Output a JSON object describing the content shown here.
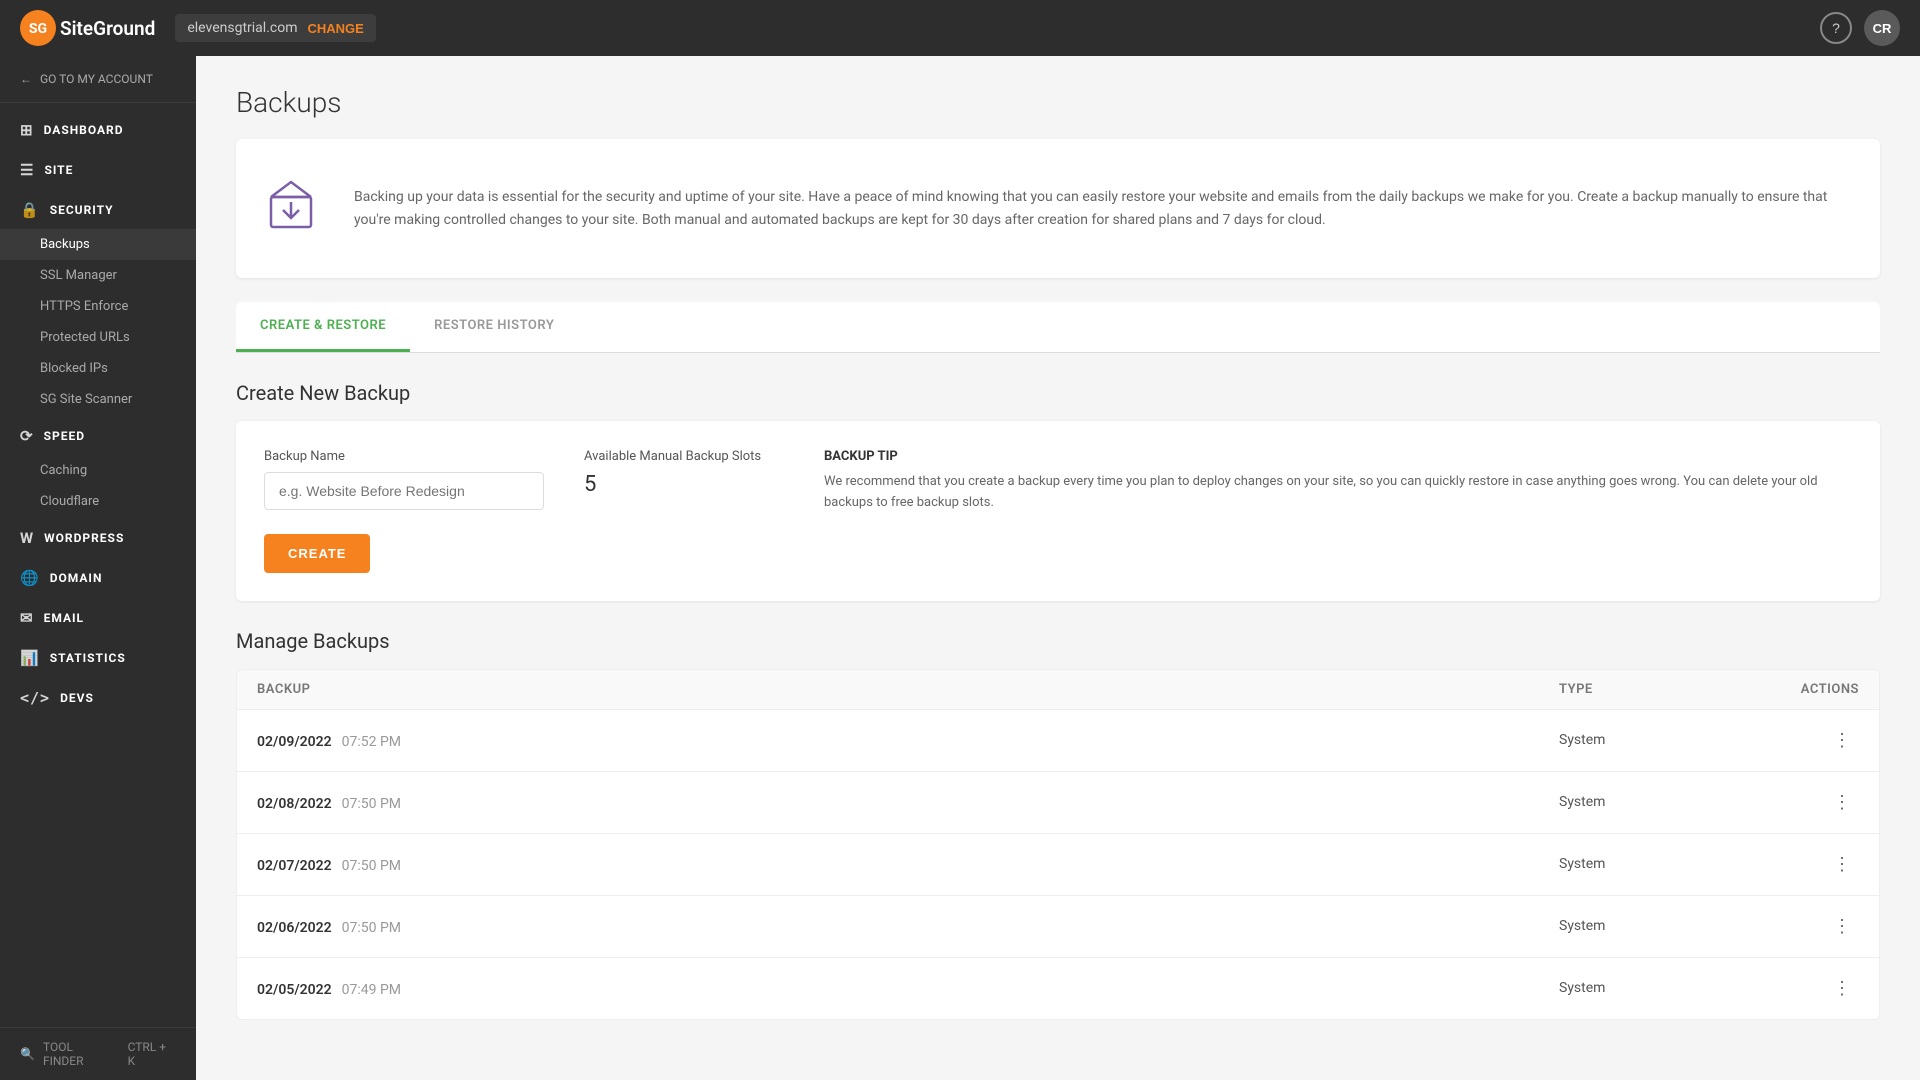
{
  "topnav": {
    "site_name": "elevensgtrial.com",
    "change_label": "CHANGE",
    "help_icon": "?",
    "avatar_label": "CR"
  },
  "sidebar": {
    "go_to_account": "GO TO MY ACCOUNT",
    "items": [
      {
        "id": "dashboard",
        "label": "DASHBOARD",
        "icon": "⊞"
      },
      {
        "id": "site",
        "label": "SITE",
        "icon": "☰"
      },
      {
        "id": "security",
        "label": "SECURITY",
        "icon": "🔒",
        "active": true
      },
      {
        "id": "backups",
        "label": "Backups",
        "sub": true,
        "active": true
      },
      {
        "id": "ssl-manager",
        "label": "SSL Manager",
        "sub": true
      },
      {
        "id": "https-enforce",
        "label": "HTTPS Enforce",
        "sub": true
      },
      {
        "id": "protected-urls",
        "label": "Protected URLs",
        "sub": true
      },
      {
        "id": "blocked-ips",
        "label": "Blocked IPs",
        "sub": true
      },
      {
        "id": "sg-site-scanner",
        "label": "SG Site Scanner",
        "sub": true
      },
      {
        "id": "speed",
        "label": "SPEED",
        "icon": "⟳"
      },
      {
        "id": "caching",
        "label": "Caching",
        "sub": true
      },
      {
        "id": "cloudflare",
        "label": "Cloudflare",
        "sub": true
      },
      {
        "id": "wordpress",
        "label": "WORDPRESS",
        "icon": "W"
      },
      {
        "id": "domain",
        "label": "DOMAIN",
        "icon": "🌐"
      },
      {
        "id": "email",
        "label": "EMAIL",
        "icon": "✉"
      },
      {
        "id": "statistics",
        "label": "STATISTICS",
        "icon": "📊"
      },
      {
        "id": "devs",
        "label": "DEVS",
        "icon": "</>"
      }
    ],
    "tool_finder_label": "TOOL FINDER",
    "tool_finder_shortcut": "CTRL + K"
  },
  "page": {
    "title": "Backups",
    "info_text": "Backing up your data is essential for the security and uptime of your site. Have a peace of mind knowing that you can easily restore your website and emails from the daily backups we make for you. Create a backup manually to ensure that you're making controlled changes to your site. Both manual and automated backups are kept for 30 days after creation for shared plans and 7 days for cloud."
  },
  "tabs": [
    {
      "id": "create-restore",
      "label": "CREATE & RESTORE",
      "active": true
    },
    {
      "id": "restore-history",
      "label": "RESTORE HISTORY",
      "active": false
    }
  ],
  "create_backup": {
    "section_title": "Create New Backup",
    "form": {
      "backup_name_label": "Backup Name",
      "backup_name_placeholder": "e.g. Website Before Redesign",
      "slots_label": "Available Manual Backup Slots",
      "slots_value": "5",
      "tip_title": "BACKUP TIP",
      "tip_text": "We recommend that you create a backup every time you plan to deploy changes on your site, so you can quickly restore in case anything goes wrong. You can delete your old backups to free backup slots.",
      "create_label": "CREATE"
    }
  },
  "manage_backups": {
    "section_title": "Manage Backups",
    "table": {
      "headers": [
        "Backup",
        "Type",
        "Actions"
      ],
      "rows": [
        {
          "date": "02/09/2022",
          "time": "07:52 PM",
          "type": "System"
        },
        {
          "date": "02/08/2022",
          "time": "07:50 PM",
          "type": "System"
        },
        {
          "date": "02/07/2022",
          "time": "07:50 PM",
          "type": "System"
        },
        {
          "date": "02/06/2022",
          "time": "07:50 PM",
          "type": "System"
        },
        {
          "date": "02/05/2022",
          "time": "07:49 PM",
          "type": "System"
        }
      ]
    }
  }
}
